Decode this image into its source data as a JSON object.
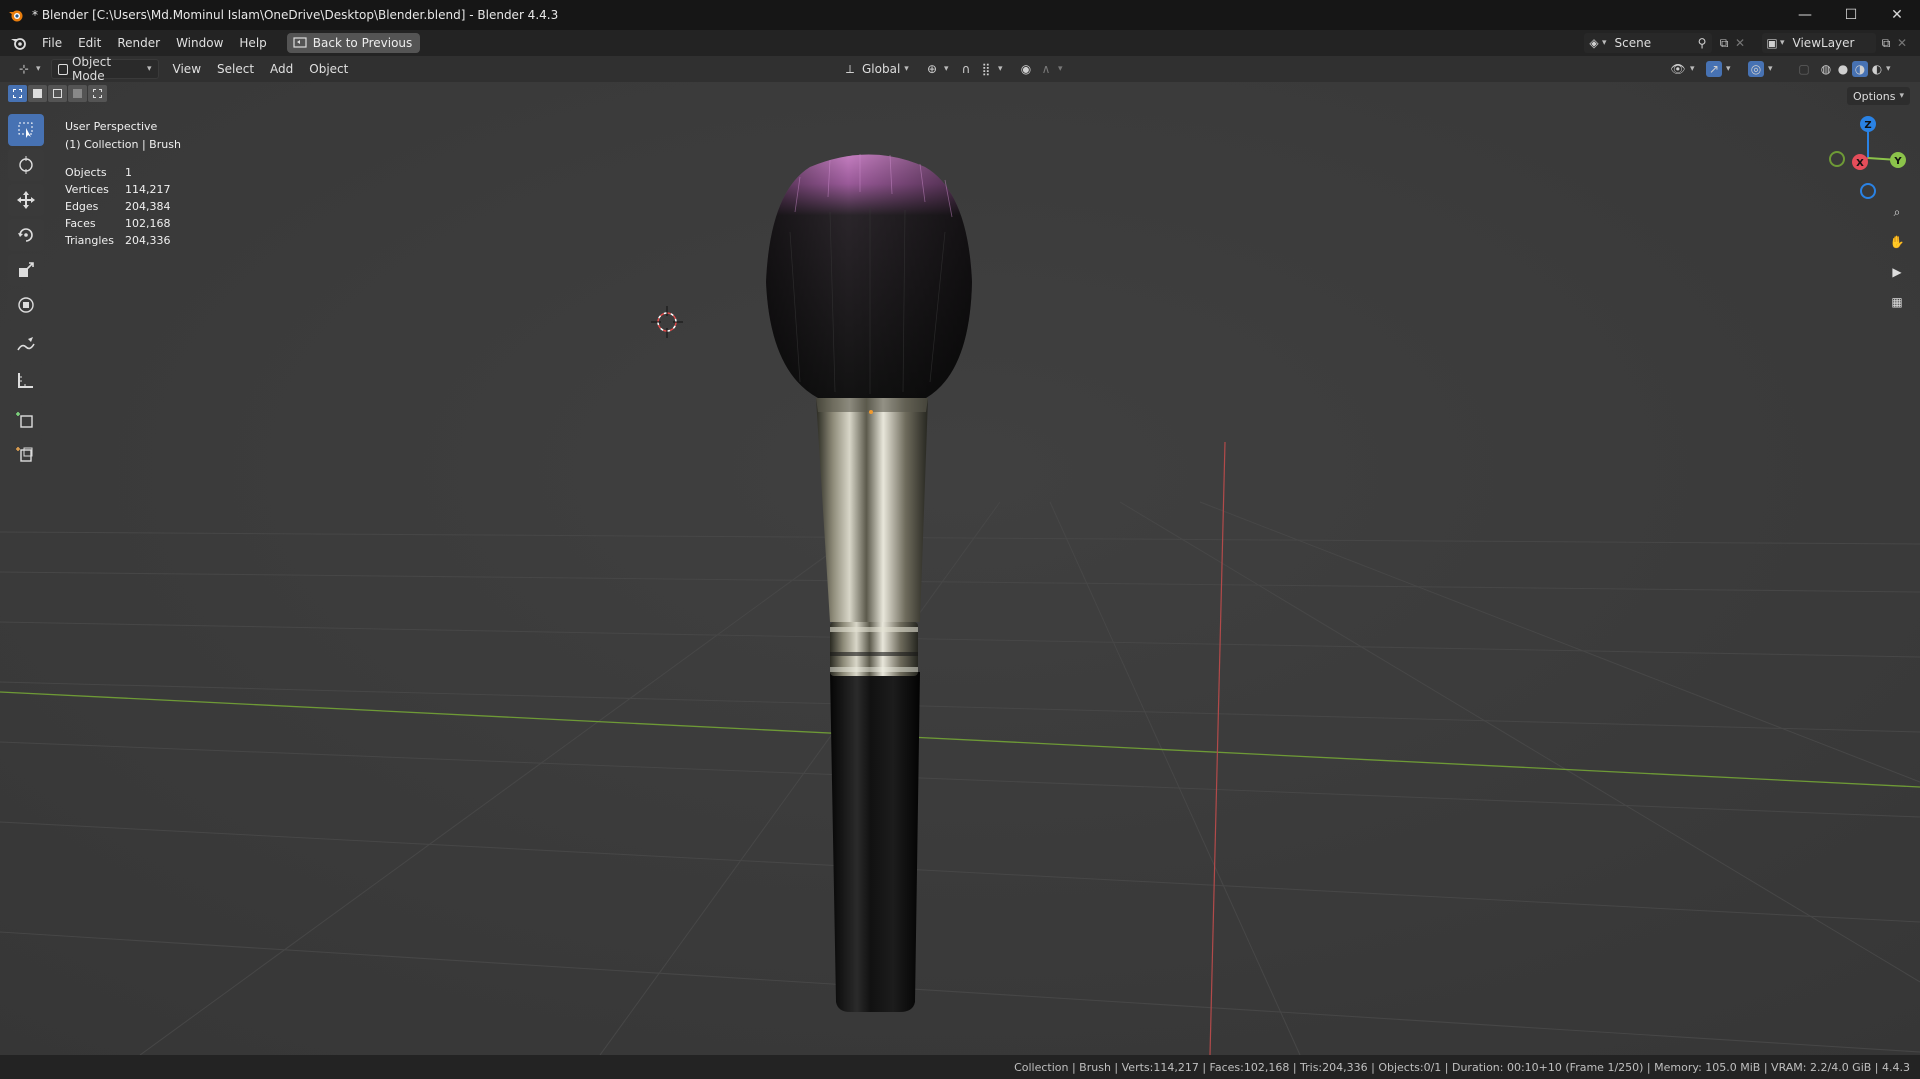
{
  "window": {
    "title": "* Blender [C:\\Users\\Md.Mominul Islam\\OneDrive\\Desktop\\Blender.blend] - Blender 4.4.3",
    "minimize": "—",
    "maximize": "☐",
    "close": "✕"
  },
  "menubar": {
    "items": [
      "File",
      "Edit",
      "Render",
      "Window",
      "Help"
    ],
    "back_button": "Back to Previous",
    "scene_label": "Scene",
    "viewlayer_label": "ViewLayer"
  },
  "viewport_header": {
    "mode": "Object Mode",
    "menus": [
      "View",
      "Select",
      "Add",
      "Object"
    ],
    "orientation": "Global",
    "options": "Options"
  },
  "overlay": {
    "view_name": "User Perspective",
    "collection": "(1) Collection | Brush",
    "stats": [
      {
        "label": "Objects",
        "value": "1"
      },
      {
        "label": "Vertices",
        "value": "114,217"
      },
      {
        "label": "Edges",
        "value": "204,384"
      },
      {
        "label": "Faces",
        "value": "102,168"
      },
      {
        "label": "Triangles",
        "value": "204,336"
      }
    ]
  },
  "gizmo": {
    "x": "X",
    "y": "Y",
    "z": "Z"
  },
  "toolbar": {
    "tools": [
      "select-box",
      "cursor",
      "move",
      "rotate",
      "scale",
      "transform",
      "annotate",
      "measure",
      "add-cube",
      "add-object"
    ]
  },
  "statusbar": {
    "text": "Collection | Brush | Verts:114,217 | Faces:102,168 | Tris:204,336 | Objects:0/1 | Duration: 00:10+10 (Frame 1/250) | Memory: 105.0 MiB | VRAM: 2.2/4.0 GiB | 4.4.3"
  },
  "colors": {
    "accent": "#4772b3",
    "viewport_bg": "#3d3d3d",
    "x_axis": "#e54d5a",
    "y_axis": "#8bc34a",
    "z_axis": "#2a82e4"
  }
}
